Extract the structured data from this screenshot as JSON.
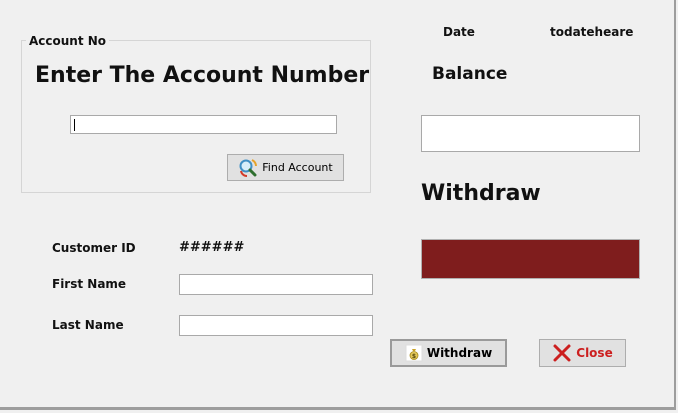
{
  "header": {
    "date_label": "Date",
    "date_value": "todateheare"
  },
  "account_group": {
    "title": "Account No",
    "heading": "Enter The Account Number",
    "account_input_value": "",
    "find_button_label": "Find Account",
    "find_icon": "find-account-icon"
  },
  "balance": {
    "label": "Balance",
    "value": ""
  },
  "withdraw": {
    "label": "Withdraw",
    "amount_color": "#7f1d1d"
  },
  "customer": {
    "id_label": "Customer ID",
    "id_value": "######",
    "first_name_label": "First Name",
    "first_name_value": "",
    "last_name_label": "Last Name",
    "last_name_value": ""
  },
  "actions": {
    "withdraw_button_label": "Withdraw",
    "withdraw_icon": "money-bag-icon",
    "close_button_label": "Close",
    "close_icon": "close-x-icon",
    "close_color": "#cc1f1f"
  }
}
